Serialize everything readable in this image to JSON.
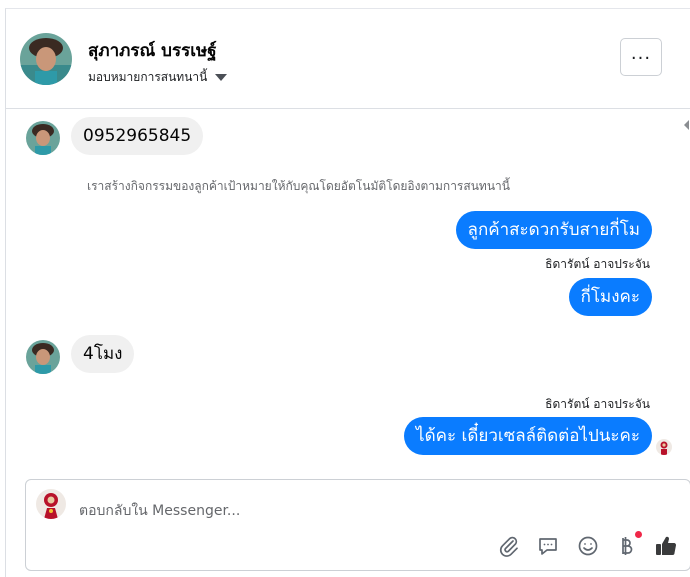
{
  "header": {
    "name": "สุภาภรณ์ บรรเษฐ์",
    "assign_label": "มอบหมายการสนทนานี้",
    "more_label": "..."
  },
  "messages": [
    {
      "direction": "incoming",
      "text": "0952965845"
    },
    {
      "direction": "notice",
      "text": "เราสร้างกิจกรรมของลูกค้าเป้าหมายให้กับคุณโดยอัตโนมัติโดยอิงตามการสนทนานี้"
    },
    {
      "direction": "outgoing",
      "text": "ลูกค้าสะดวกรับสายกี่โม"
    },
    {
      "direction": "outgoing",
      "sender": "ธิดารัตน์ อาจประจัน",
      "text": "กี่โมงคะ"
    },
    {
      "direction": "incoming",
      "text": "4โมง"
    },
    {
      "direction": "outgoing",
      "sender": "ธิดารัตน์ อาจประจัน",
      "text": "ได้คะ เดี๋ยวเซลล์ติดต่อไปนะคะ"
    }
  ],
  "composer": {
    "placeholder": "ตอบกลับใน Messenger...",
    "tools": [
      "paperclip-icon",
      "chat-bubble-icon",
      "emoji-icon",
      "baht-icon",
      "thumbs-up-icon"
    ]
  },
  "colors": {
    "outgoing_bubble": "#0a7cff",
    "incoming_bubble": "#f0f0f0",
    "notification_dot": "#f02849"
  }
}
